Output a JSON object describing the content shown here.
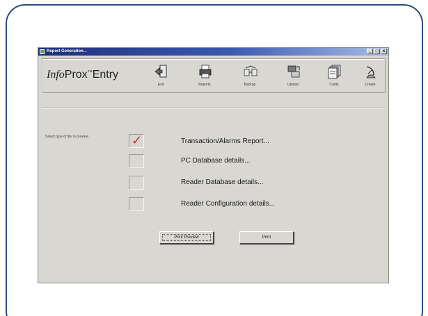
{
  "window": {
    "title": "Report Generation...",
    "controls": [
      "_",
      "□",
      "x"
    ]
  },
  "brand": {
    "info": "Info",
    "prox": "Prox",
    "tm": "™",
    "entry": "Entry"
  },
  "toolbar": {
    "items": [
      {
        "label": "Exit",
        "icon": "exit-door-icon"
      },
      {
        "label": "Reports",
        "icon": "printer-icon"
      },
      {
        "label": "Backup",
        "icon": "backup-icon"
      },
      {
        "label": "Upload",
        "icon": "upload-icon"
      },
      {
        "label": "Cards",
        "icon": "cards-icon"
      },
      {
        "label": "Create",
        "icon": "satellite-dish-icon"
      }
    ]
  },
  "main": {
    "prompt": "Select type of file to preview",
    "options": [
      {
        "label": "Transaction/Alarms Report...",
        "checked": true
      },
      {
        "label": "PC Database details...",
        "checked": false
      },
      {
        "label": "Reader Database details...",
        "checked": false
      },
      {
        "label": "Reader Configuration details...",
        "checked": false
      }
    ],
    "check_mark": "✓",
    "preview_button": "Print Preview",
    "print_button": "Print"
  },
  "colors": {
    "frame_border": "#2b4d7e",
    "window_bg": "#d8d7d2",
    "check_mark": "#d42a2a",
    "titlebar_start": "#1f2f78"
  }
}
